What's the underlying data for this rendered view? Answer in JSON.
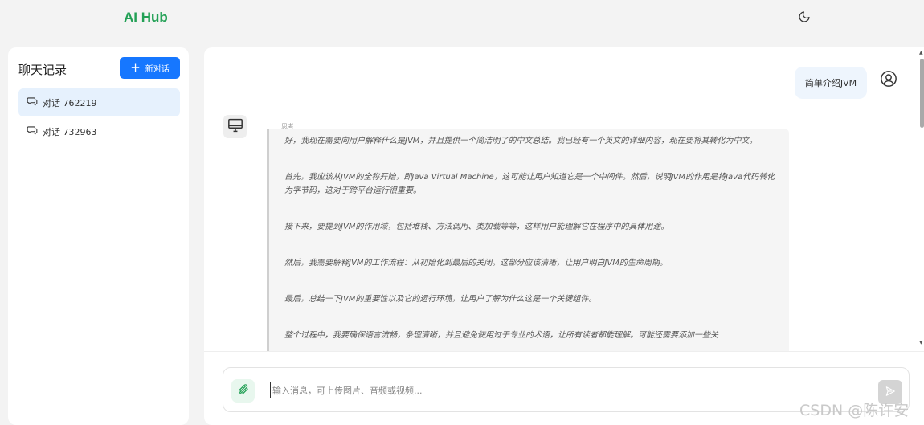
{
  "app": {
    "title": "AI Hub"
  },
  "header": {
    "theme_icon": "moon-icon"
  },
  "sidebar": {
    "title": "聊天记录",
    "new_chat_label": "新对话",
    "conversations": [
      {
        "label": "对话 762219",
        "active": true
      },
      {
        "label": "对话 732963",
        "active": false
      }
    ]
  },
  "chat": {
    "user_message": "简单介绍JVM",
    "think_label": "思考",
    "thinking": [
      "好，我现在需要向用户解释什么是JVM，并且提供一个简洁明了的中文总结。我已经有一个英文的详细内容，现在要将其转化为中文。",
      "首先，我应该从JVM的全称开始，即Java Virtual Machine，这可能让用户知道它是一个中间件。然后，说明JVM的作用是将Java代码转化为字节码，这对于跨平台运行很重要。",
      "接下来，要提到JVM的作用域，包括堆栈、方法调用、类加载等等，这样用户能理解它在程序中的具体用途。",
      "然后，我需要解释JVM的工作流程：从初始化到最后的关闭。这部分应该清晰，让用户明白JVM的生命周期。",
      "最后，总结一下JVM的重要性以及它的运行环境，让用户了解为什么这是一个关键组件。",
      "整个过程中，我要确保语言流畅，条理清晰，并且避免使用过于专业的术语，让所有读者都能理解。可能还需要添加一些关"
    ]
  },
  "input": {
    "placeholder": "输入消息，可上传图片、音频或视频..."
  },
  "watermark": "CSDN @陈许安",
  "colors": {
    "brand": "#22a055",
    "primary": "#1677ff",
    "active_item": "#e6f1fd"
  }
}
